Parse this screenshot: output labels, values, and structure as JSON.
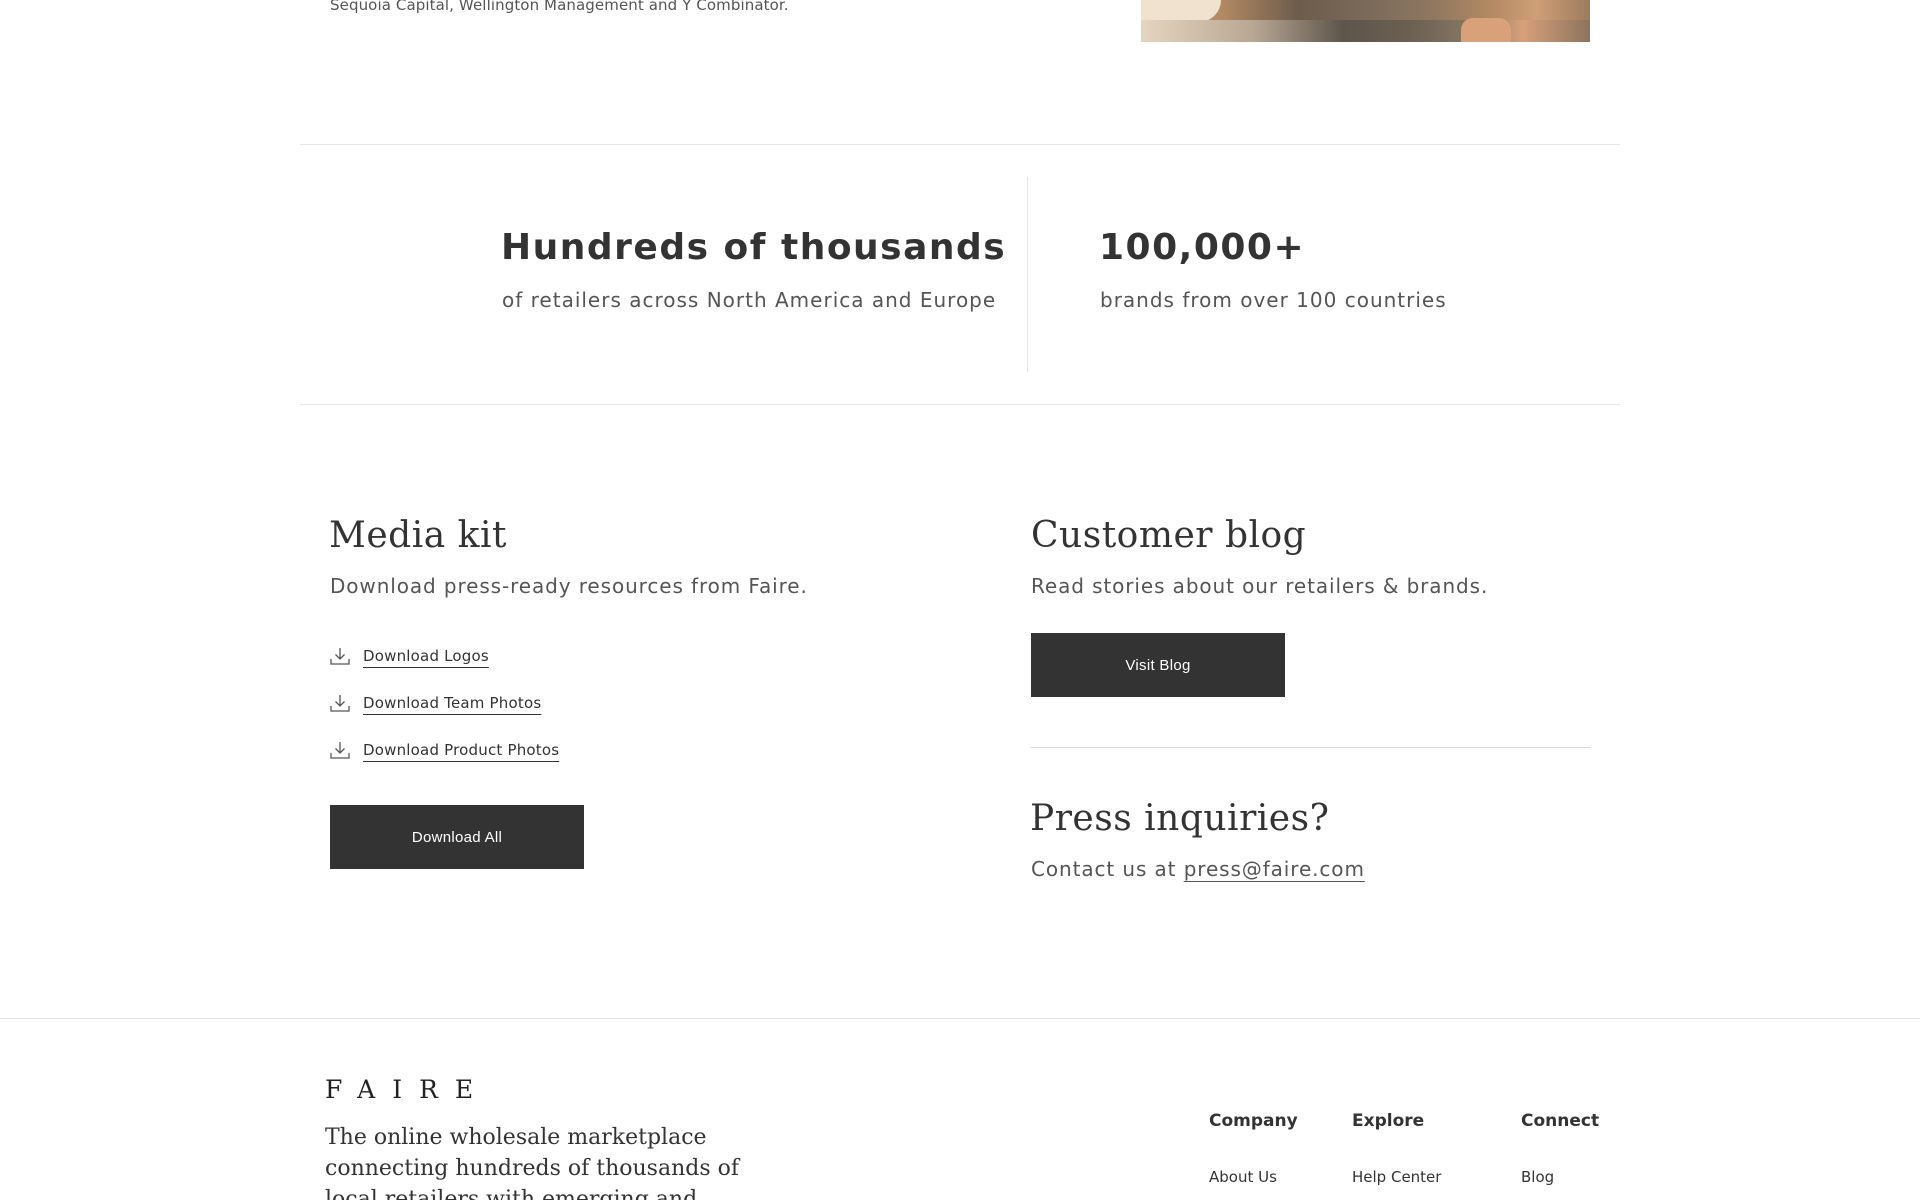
{
  "top": {
    "caption": "Sequoia Capital, Wellington Management and Y Combinator."
  },
  "stats": [
    {
      "title": "Hundreds of thousands",
      "subtitle": "of retailers across North America and Europe"
    },
    {
      "title": "100,000+",
      "subtitle": "brands from over 100 countries"
    }
  ],
  "media_kit": {
    "title": "Media kit",
    "subtitle": "Download press-ready resources from Faire.",
    "links": [
      "Download Logos",
      "Download Team Photos",
      "Download Product Photos"
    ],
    "download_all_label": "Download All",
    "icon": "download-icon"
  },
  "customer_blog": {
    "title": "Customer blog",
    "subtitle": "Read stories about our retailers & brands.",
    "button_label": "Visit Blog"
  },
  "press": {
    "title": "Press inquiries?",
    "prefix": "Contact us at ",
    "email": "press@faire.com"
  },
  "footer": {
    "logo": "FAIRE",
    "tagline": "The online wholesale marketplace connecting hundreds of thousands of local retailers with emerging and established",
    "columns": [
      {
        "heading": "Company",
        "first_link": "About Us"
      },
      {
        "heading": "Explore",
        "first_link": "Help Center"
      },
      {
        "heading": "Connect",
        "first_link": "Blog"
      }
    ]
  },
  "colors": {
    "text": "#333333",
    "muted": "#555555",
    "button_bg": "#333333",
    "button_text": "#ffffff",
    "divider": "#e6e6e6"
  }
}
